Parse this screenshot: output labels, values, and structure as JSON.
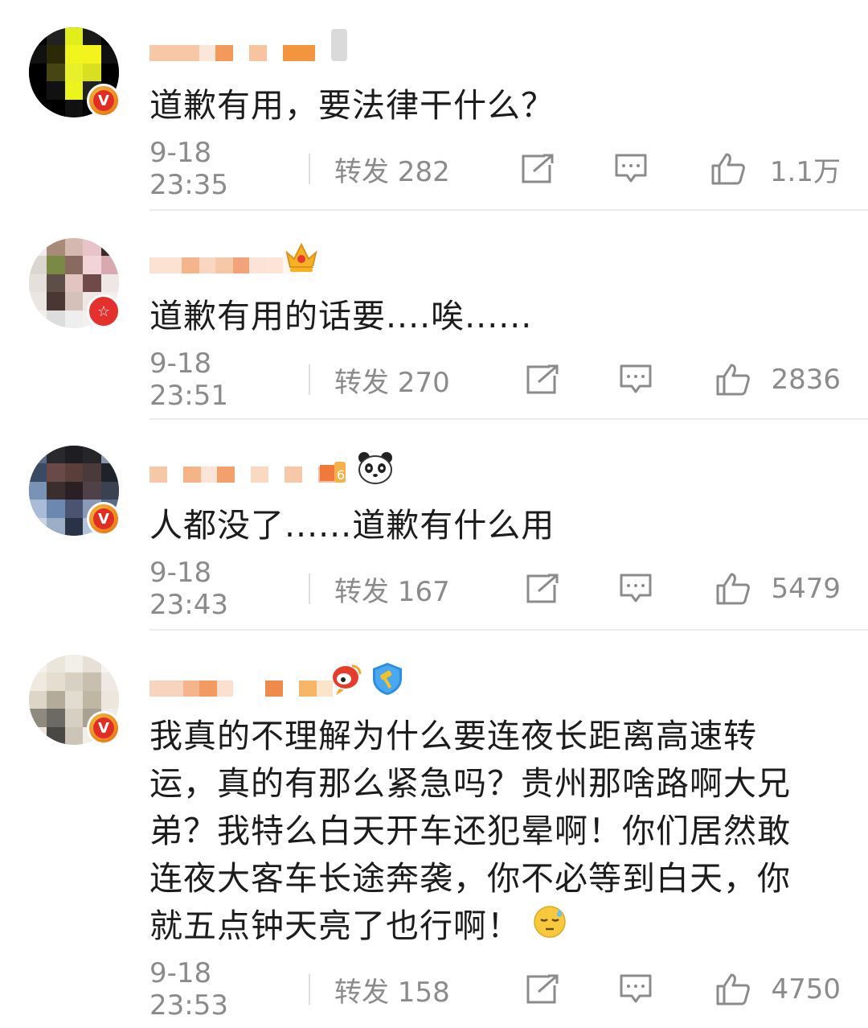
{
  "comments": [
    {
      "text": "道歉有用，要法律干什么？",
      "time": "9-18 23:35",
      "forward": "转发 282",
      "likes": "1.1万",
      "badge": "v-icon"
    },
    {
      "text": "道歉有用的话要....唉......",
      "time": "9-18 23:51",
      "forward": "转发 270",
      "likes": "2836",
      "badge": "star-icon",
      "name_badge": "crown-level-icon"
    },
    {
      "text": "人都没了......道歉有什么用",
      "time": "9-18 23:43",
      "forward": "转发 167",
      "likes": "5479",
      "badge": "v-icon",
      "name_badge": "panda-icon"
    },
    {
      "text_lines": [
        "我真的不理解为什么要连夜长距离高速转",
        "运，真的有那么紧急吗？贵州那啥路啊大兄",
        "弟？我特么白天开车还犯晕啊！你们居然敢",
        "连夜大客车长途奔袭，你不必等到白天，你",
        "就五点钟天亮了也行啊！"
      ],
      "time": "9-18 23:53",
      "forward": "转发 158",
      "likes": "4750",
      "badge": "v-icon",
      "name_badges": [
        "weibo-icon",
        "gavel-shield-icon"
      ],
      "trailing_emoji": "sweat-face-icon"
    }
  ],
  "colors": {
    "meta_gray": "#8b8b8b",
    "text": "#1c1c1c",
    "divider": "#ececec",
    "v_badge": "#e02e24"
  }
}
